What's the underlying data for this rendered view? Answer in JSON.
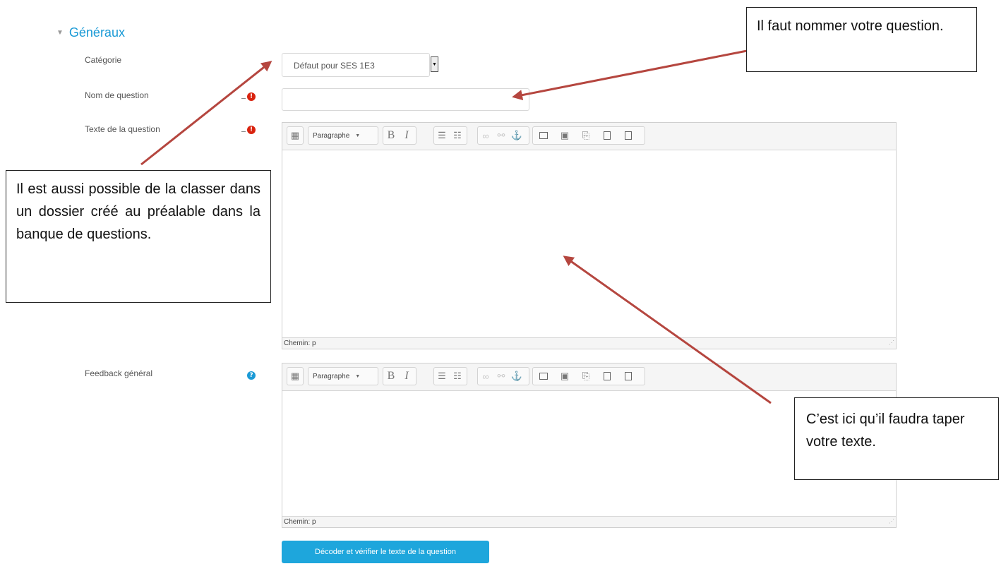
{
  "section": {
    "title": "Généraux"
  },
  "fields": {
    "category_label": "Catégorie",
    "category_value": "Défaut pour SES 1E3",
    "name_label": "Nom de question",
    "question_text_label": "Texte de la question",
    "feedback_label": "Feedback général"
  },
  "editor": {
    "paragraph_label": "Paragraphe",
    "bold": "B",
    "italic": "I",
    "path_label": "Chemin: p"
  },
  "decode_button": "Décoder et vérifier le texte de la question",
  "annotations": {
    "name_note": "Il faut nommer votre question.",
    "category_note": "Il est aussi possible de la classer dans un dossier créé au préalable dans la banque de questions.",
    "text_note": "C’est ici qu’il faudra taper votre texte."
  },
  "colors": {
    "accent": "#1a9ad6",
    "required": "#d9230f",
    "arrow": "#b5463f",
    "button": "#1ea6dc"
  },
  "icons": [
    "caret-down-icon",
    "required-icon",
    "help-icon",
    "keyboard-icon",
    "bullet-list-icon",
    "numbered-list-icon",
    "link-icon",
    "unlink-icon",
    "anchor-icon",
    "image-icon",
    "media-icon",
    "file-icon",
    "manage-files-icon",
    "record-icon"
  ]
}
